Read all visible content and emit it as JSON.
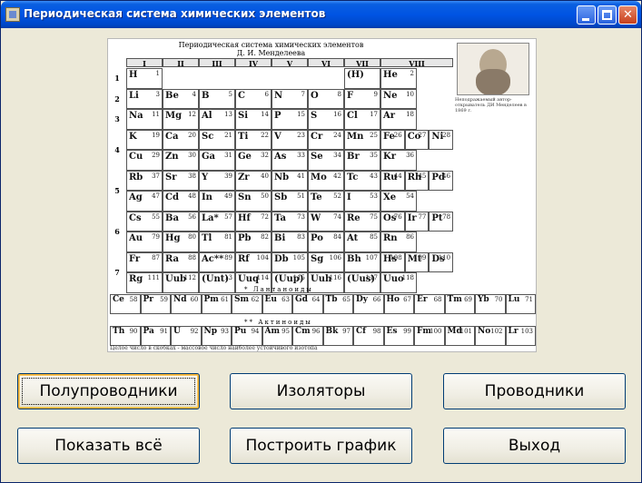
{
  "window": {
    "title": "Периодическая система химических элементов",
    "controls": {
      "minimize": "minimize-icon",
      "maximize": "maximize-icon",
      "close": "close-icon"
    }
  },
  "ptable": {
    "title": "Периодическая система химических элементов",
    "subtitle": "Д. И. Менделеева",
    "groups": [
      "I",
      "II",
      "III",
      "IV",
      "V",
      "VI",
      "VII",
      "VIII"
    ],
    "portrait_caption": "Неподражаемый автор-открыватель ДИ Менделеев в 1869 г.",
    "lanthanides_label": "* Лантаноиды",
    "actinides_label": "** Актиноиды",
    "footnote": "Целое число в скобках - массовое число наиболее устойчивого изотопа",
    "periods": [
      "1",
      "2",
      "3",
      "4",
      "5",
      "6",
      "7"
    ],
    "rows": [
      {
        "cells": [
          {
            "s": "H",
            "n": "1"
          },
          {
            "s": "(H)",
            "n": ""
          },
          {
            "s": "He",
            "n": "2"
          }
        ]
      },
      {
        "cells": [
          {
            "s": "Li",
            "n": "3"
          },
          {
            "s": "Be",
            "n": "4"
          },
          {
            "s": "B",
            "n": "5"
          },
          {
            "s": "C",
            "n": "6"
          },
          {
            "s": "N",
            "n": "7"
          },
          {
            "s": "O",
            "n": "8"
          },
          {
            "s": "F",
            "n": "9"
          },
          {
            "s": "Ne",
            "n": "10"
          }
        ]
      },
      {
        "cells": [
          {
            "s": "Na",
            "n": "11"
          },
          {
            "s": "Mg",
            "n": "12"
          },
          {
            "s": "Al",
            "n": "13"
          },
          {
            "s": "Si",
            "n": "14"
          },
          {
            "s": "P",
            "n": "15"
          },
          {
            "s": "S",
            "n": "16"
          },
          {
            "s": "Cl",
            "n": "17"
          },
          {
            "s": "Ar",
            "n": "18"
          }
        ]
      },
      {
        "cells": [
          {
            "s": "K",
            "n": "19"
          },
          {
            "s": "Ca",
            "n": "20"
          },
          {
            "s": "Sc",
            "n": "21"
          },
          {
            "s": "Ti",
            "n": "22"
          },
          {
            "s": "V",
            "n": "23"
          },
          {
            "s": "Cr",
            "n": "24"
          },
          {
            "s": "Mn",
            "n": "25"
          },
          {
            "s": "Fe",
            "n": "26"
          },
          {
            "s": "Co",
            "n": "27"
          },
          {
            "s": "Ni",
            "n": "28"
          }
        ]
      },
      {
        "cells": [
          {
            "s": "Cu",
            "n": "29"
          },
          {
            "s": "Zn",
            "n": "30"
          },
          {
            "s": "Ga",
            "n": "31"
          },
          {
            "s": "Ge",
            "n": "32"
          },
          {
            "s": "As",
            "n": "33"
          },
          {
            "s": "Se",
            "n": "34"
          },
          {
            "s": "Br",
            "n": "35"
          },
          {
            "s": "Kr",
            "n": "36"
          }
        ]
      },
      {
        "cells": [
          {
            "s": "Rb",
            "n": "37"
          },
          {
            "s": "Sr",
            "n": "38"
          },
          {
            "s": "Y",
            "n": "39"
          },
          {
            "s": "Zr",
            "n": "40"
          },
          {
            "s": "Nb",
            "n": "41"
          },
          {
            "s": "Mo",
            "n": "42"
          },
          {
            "s": "Tc",
            "n": "43"
          },
          {
            "s": "Ru",
            "n": "44"
          },
          {
            "s": "Rh",
            "n": "45"
          },
          {
            "s": "Pd",
            "n": "46"
          }
        ]
      },
      {
        "cells": [
          {
            "s": "Ag",
            "n": "47"
          },
          {
            "s": "Cd",
            "n": "48"
          },
          {
            "s": "In",
            "n": "49"
          },
          {
            "s": "Sn",
            "n": "50"
          },
          {
            "s": "Sb",
            "n": "51"
          },
          {
            "s": "Te",
            "n": "52"
          },
          {
            "s": "I",
            "n": "53"
          },
          {
            "s": "Xe",
            "n": "54"
          }
        ]
      },
      {
        "cells": [
          {
            "s": "Cs",
            "n": "55"
          },
          {
            "s": "Ba",
            "n": "56"
          },
          {
            "s": "La*",
            "n": "57"
          },
          {
            "s": "Hf",
            "n": "72"
          },
          {
            "s": "Ta",
            "n": "73"
          },
          {
            "s": "W",
            "n": "74"
          },
          {
            "s": "Re",
            "n": "75"
          },
          {
            "s": "Os",
            "n": "76"
          },
          {
            "s": "Ir",
            "n": "77"
          },
          {
            "s": "Pt",
            "n": "78"
          }
        ]
      },
      {
        "cells": [
          {
            "s": "Au",
            "n": "79"
          },
          {
            "s": "Hg",
            "n": "80"
          },
          {
            "s": "Tl",
            "n": "81"
          },
          {
            "s": "Pb",
            "n": "82"
          },
          {
            "s": "Bi",
            "n": "83"
          },
          {
            "s": "Po",
            "n": "84"
          },
          {
            "s": "At",
            "n": "85"
          },
          {
            "s": "Rn",
            "n": "86"
          }
        ]
      },
      {
        "cells": [
          {
            "s": "Fr",
            "n": "87"
          },
          {
            "s": "Ra",
            "n": "88"
          },
          {
            "s": "Ac**",
            "n": "89"
          },
          {
            "s": "Rf",
            "n": "104"
          },
          {
            "s": "Db",
            "n": "105"
          },
          {
            "s": "Sg",
            "n": "106"
          },
          {
            "s": "Bh",
            "n": "107"
          },
          {
            "s": "Hs",
            "n": "108"
          },
          {
            "s": "Mt",
            "n": "109"
          },
          {
            "s": "Ds",
            "n": "110"
          }
        ]
      },
      {
        "cells": [
          {
            "s": "Rg",
            "n": "111"
          },
          {
            "s": "Uub",
            "n": "112"
          },
          {
            "s": "(Unt)",
            "n": "113"
          },
          {
            "s": "Uuq",
            "n": "114"
          },
          {
            "s": "(Uup)",
            "n": "115"
          },
          {
            "s": "Uuh",
            "n": "116"
          },
          {
            "s": "(Uus)",
            "n": "117"
          },
          {
            "s": "Uuo",
            "n": "118"
          }
        ]
      }
    ],
    "lanthanides": [
      {
        "s": "Ce",
        "n": "58"
      },
      {
        "s": "Pr",
        "n": "59"
      },
      {
        "s": "Nd",
        "n": "60"
      },
      {
        "s": "Pm",
        "n": "61"
      },
      {
        "s": "Sm",
        "n": "62"
      },
      {
        "s": "Eu",
        "n": "63"
      },
      {
        "s": "Gd",
        "n": "64"
      },
      {
        "s": "Tb",
        "n": "65"
      },
      {
        "s": "Dy",
        "n": "66"
      },
      {
        "s": "Ho",
        "n": "67"
      },
      {
        "s": "Er",
        "n": "68"
      },
      {
        "s": "Tm",
        "n": "69"
      },
      {
        "s": "Yb",
        "n": "70"
      },
      {
        "s": "Lu",
        "n": "71"
      }
    ],
    "actinides": [
      {
        "s": "Th",
        "n": "90"
      },
      {
        "s": "Pa",
        "n": "91"
      },
      {
        "s": "U",
        "n": "92"
      },
      {
        "s": "Np",
        "n": "93"
      },
      {
        "s": "Pu",
        "n": "94"
      },
      {
        "s": "Am",
        "n": "95"
      },
      {
        "s": "Cm",
        "n": "96"
      },
      {
        "s": "Bk",
        "n": "97"
      },
      {
        "s": "Cf",
        "n": "98"
      },
      {
        "s": "Es",
        "n": "99"
      },
      {
        "s": "Fm",
        "n": "100"
      },
      {
        "s": "Md",
        "n": "101"
      },
      {
        "s": "No",
        "n": "102"
      },
      {
        "s": "Lr",
        "n": "103"
      }
    ]
  },
  "buttons": {
    "semiconductors": "Полупроводники",
    "insulators": "Изоляторы",
    "conductors": "Проводники",
    "show_all": "Показать всё",
    "build_chart": "Построить график",
    "exit": "Выход"
  }
}
